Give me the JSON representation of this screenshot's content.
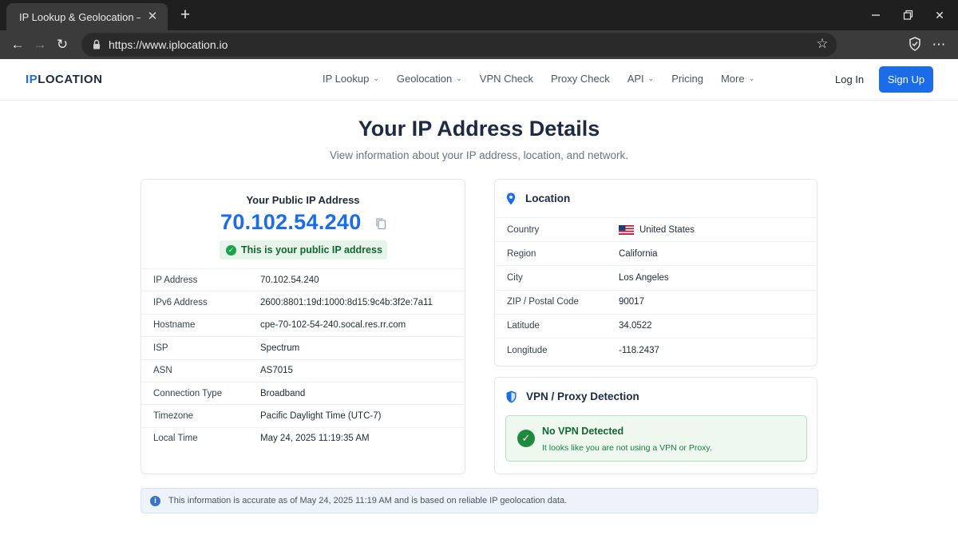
{
  "browser": {
    "tab_title": "IP Lookup & Geolocation – IPLocation",
    "url": "https://www.iplocation.io"
  },
  "header": {
    "logo_accent": "IP",
    "logo_rest": "LOCATION",
    "nav": [
      {
        "label": "IP Lookup",
        "dropdown": true
      },
      {
        "label": "Geolocation",
        "dropdown": true
      },
      {
        "label": "VPN Check",
        "dropdown": false
      },
      {
        "label": "Proxy Check",
        "dropdown": false
      },
      {
        "label": "API",
        "dropdown": true
      },
      {
        "label": "Pricing",
        "dropdown": false
      },
      {
        "label": "More",
        "dropdown": true
      }
    ],
    "login_label": "Log In",
    "signup_label": "Sign Up"
  },
  "page": {
    "title": "Your IP Address Details",
    "subtitle": "View information about your IP address, location, and network."
  },
  "ip_card": {
    "label": "Your Public IP Address",
    "ip": "70.102.54.240",
    "badge": "This is your public IP address",
    "rows": [
      {
        "key": "IP Address",
        "value": "70.102.54.240"
      },
      {
        "key": "IPv6 Address",
        "value": "2600:8801:19d:1000:8d15:9c4b:3f2e:7a11"
      },
      {
        "key": "Hostname",
        "value": "cpe-70-102-54-240.socal.res.rr.com"
      },
      {
        "key": "ISP",
        "value": "Spectrum"
      },
      {
        "key": "ASN",
        "value": "AS7015"
      },
      {
        "key": "Connection Type",
        "value": "Broadband"
      },
      {
        "key": "Timezone",
        "value": "Pacific Daylight Time (UTC-7)"
      },
      {
        "key": "Local Time",
        "value": "May 24, 2025 11:19:35 AM"
      }
    ]
  },
  "location": {
    "title": "Location",
    "rows": [
      {
        "key": "Country",
        "value": "United States",
        "flag": "us-flag"
      },
      {
        "key": "Region",
        "value": "California"
      },
      {
        "key": "City",
        "value": "Los Angeles"
      },
      {
        "key": "ZIP / Postal Code",
        "value": "90017"
      },
      {
        "key": "Latitude",
        "value": "34.0522"
      },
      {
        "key": "Longitude",
        "value": "-118.2437"
      }
    ]
  },
  "vpn": {
    "title": "VPN / Proxy Detection",
    "status": "No VPN Detected",
    "description": "It looks like you are not using a VPN or Proxy."
  },
  "info": {
    "text": "This information is accurate as of May 24, 2025 11:19 AM and is based on reliable IP geolocation data."
  },
  "colors": {
    "accent": "#1a6ce8",
    "success": "#16a34a",
    "info": "#3b74c5"
  }
}
